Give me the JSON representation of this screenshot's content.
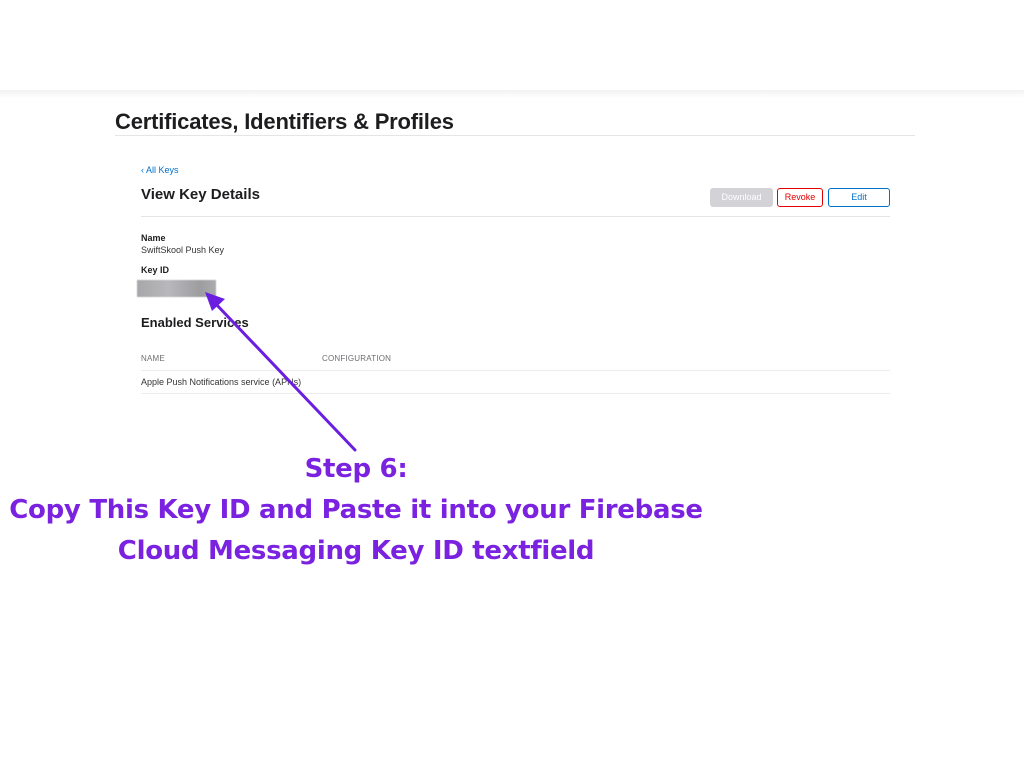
{
  "header": {
    "title": "Certificates, Identifiers & Profiles"
  },
  "key_details": {
    "back_link": "‹ All Keys",
    "heading": "View Key Details",
    "buttons": {
      "download": "Download",
      "revoke": "Revoke",
      "edit": "Edit"
    },
    "name_label": "Name",
    "name_value": "SwiftSkool Push Key",
    "key_id_label": "Key ID"
  },
  "services": {
    "heading": "Enabled Services",
    "columns": [
      "NAME",
      "CONFIGURATION"
    ],
    "rows": [
      {
        "name": "Apple Push Notifications service (APNs)",
        "configuration": ""
      }
    ]
  },
  "annotation": {
    "step": "Step 6:",
    "line1": "Copy This Key ID and Paste it into your Firebase",
    "line2": "Cloud Messaging Key ID textfield",
    "color": "#7a22e0"
  }
}
